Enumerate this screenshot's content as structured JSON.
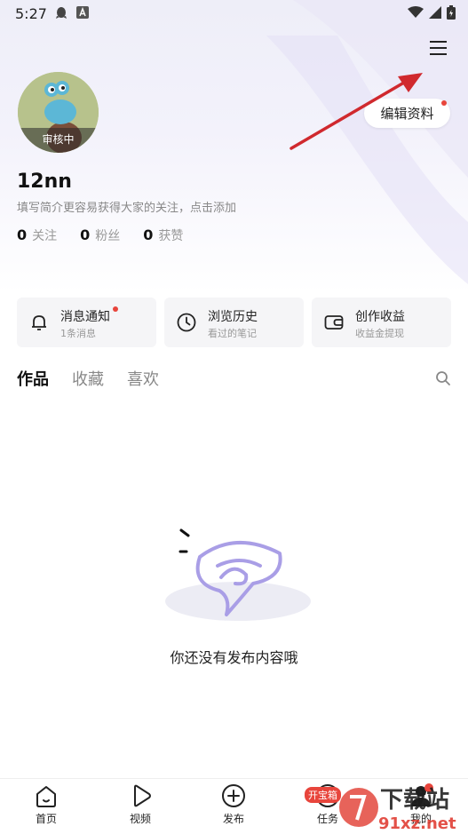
{
  "status_bar": {
    "time": "5:27",
    "left_icons": [
      "qq-icon",
      "app-a-icon"
    ],
    "right_icons": [
      "wifi-icon",
      "signal-icon",
      "battery-icon"
    ]
  },
  "header": {
    "menu_icon": "hamburger-menu-icon",
    "edit_profile_label": "编辑资料"
  },
  "profile": {
    "avatar_status": "审核中",
    "username": "12nn",
    "bio_placeholder": "填写简介更容易获得大家的关注，点击添加",
    "stats": [
      {
        "value": "0",
        "label": "关注"
      },
      {
        "value": "0",
        "label": "粉丝"
      },
      {
        "value": "0",
        "label": "获赞"
      }
    ]
  },
  "cards": [
    {
      "title": "消息通知",
      "subtitle": "1条消息",
      "icon": "bell-icon",
      "has_dot": true
    },
    {
      "title": "浏览历史",
      "subtitle": "看过的笔记",
      "icon": "clock-icon",
      "has_dot": false
    },
    {
      "title": "创作收益",
      "subtitle": "收益金提现",
      "icon": "wallet-icon",
      "has_dot": false
    }
  ],
  "content_tabs": [
    {
      "label": "作品",
      "active": true
    },
    {
      "label": "收藏",
      "active": false
    },
    {
      "label": "喜欢",
      "active": false
    }
  ],
  "empty_state": {
    "message": "你还没有发布内容哦"
  },
  "bottom_nav": [
    {
      "label": "首页",
      "icon": "home-icon"
    },
    {
      "label": "视频",
      "icon": "play-icon"
    },
    {
      "label": "发布",
      "icon": "plus-circle-icon"
    },
    {
      "label": "任务",
      "icon": "task-icon",
      "badge": "开宝箱"
    },
    {
      "label": "我的",
      "icon": "profile-icon"
    }
  ],
  "watermark": {
    "line1": "下载站",
    "line2": "91xz.net"
  },
  "colors": {
    "accent_red": "#e8453c",
    "annotation_arrow": "#d0292e",
    "illustration_purple": "#a99ee6"
  }
}
